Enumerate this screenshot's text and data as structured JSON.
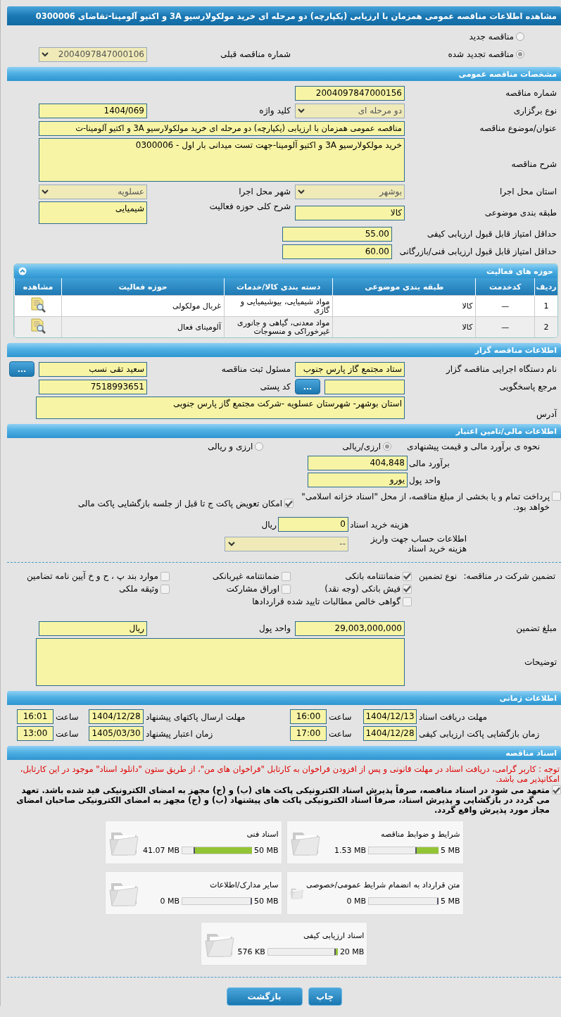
{
  "title": "مشاهده اطلاعات مناقصه عمومی همزمان با ارزیابی (یکپارچه) دو مرحله ای خرید مولکولارسیو 3A و اکتیو آلومینا-تقاضای 0300006",
  "tender_kind": [
    {
      "label": "مناقصه جدید",
      "selected": false
    },
    {
      "label": "مناقصه تجدید شده",
      "selected": true
    }
  ],
  "previous_tender": {
    "label": "شماره مناقصه قبلی",
    "value": "2004097847000106"
  },
  "general": {
    "title": "مشخصات مناقصه عمومی",
    "rows": [
      [
        {
          "label": "شماره مناقصه",
          "kind": "text",
          "value": "2004097847000156"
        }
      ],
      [
        {
          "label": "نوع برگزاری",
          "kind": "select",
          "value": "دو مرحله ای"
        },
        {
          "label": "کلید واژه",
          "kind": "text",
          "value": "1404/069"
        }
      ],
      [
        {
          "label": "عنوان/موضوع مناقصه",
          "kind": "wide",
          "value": "مناقصه عمومی همزمان با ارزیابی (یکپارچه) دو مرحله ای خرید مولکولارسیو 3A و اکتیو آلومینا-ت"
        }
      ],
      [
        {
          "label": "شرح مناقصه",
          "kind": "area",
          "value": "خرید مولکولارسیو 3A و اکتیو آلومینا-جهت تست میدانی بار اول - 0300006"
        }
      ],
      [
        {
          "label": "استان محل اجرا",
          "kind": "select",
          "value": "بوشهر"
        },
        {
          "label": "شهر محل اجرا",
          "kind": "select",
          "value": "عسلویه"
        }
      ],
      [
        {
          "label": "طبقه بندی موضوعی",
          "kind": "text",
          "value": "کالا"
        },
        {
          "label": "شرح کلی حوزه فعالیت",
          "kind": "tall",
          "value": "شیمیایی"
        }
      ],
      [
        {
          "label": "حداقل امتیاز قابل قبول ارزیابی کیفی",
          "kind": "text",
          "value": "55.00"
        }
      ],
      [
        {
          "label": "حداقل امتیاز قابل قبول ارزیابی فنی/بازرگانی",
          "kind": "text",
          "value": "60.00"
        }
      ]
    ]
  },
  "activities": {
    "title": "حوزه های فعالیت",
    "columns": [
      "ردیف",
      "کدخدمت",
      "طبقه بندی موضوعی",
      "دسته بندی کالا/خدمات",
      "حوزه فعالیت",
      "مشاهده"
    ],
    "rows": [
      {
        "cells": [
          "1",
          "—",
          "کالا",
          "مواد شیمیایی، بیوشیمیایی و گازی",
          "غربال مولکولی"
        ]
      },
      {
        "cells": [
          "2",
          "—",
          "کالا",
          "مواد معدنی، گیاهی و جانوری غیرخوراکی و منسوجات",
          "آلومینای فعال"
        ]
      }
    ]
  },
  "organizer": {
    "title": "اطلاعات مناقصه گزار",
    "rows": [
      [
        {
          "label": "نام دستگاه اجرایی مناقصه گزار",
          "kind": "text",
          "value": "ستاد مجتمع گاز پارس جنوب"
        },
        {
          "label": "مسئول ثبت مناقصه",
          "kind": "lookup",
          "value": "سعید تقی نسب",
          "button": "..."
        }
      ],
      [
        {
          "label": "مرجع پاسخگویی",
          "kind": "lookup",
          "button": "..."
        },
        {
          "label": "کد پستی",
          "kind": "text",
          "value": "7518993651"
        }
      ],
      [
        {
          "label": "آدرس",
          "kind": "address",
          "value": "استان بوشهر- شهرستان عسلویه -شرکت مجتمع گاز پارس جنوبی"
        }
      ]
    ]
  },
  "finance": {
    "title": "اطلاعات مالی/تامین اعتبار",
    "estimate_method": {
      "label": "نحوه ی برآورد مالی و قیمت پیشنهادی",
      "options": [
        {
          "label": "ارزی/ریالی",
          "selected": true
        },
        {
          "label": "ارزی و ریالی",
          "selected": false
        }
      ]
    },
    "fields": [
      {
        "label": "برآورد مالی",
        "value": "404,848"
      },
      {
        "label": "واحد پول",
        "value": "یورو"
      }
    ],
    "options": [
      {
        "label": "پرداخت تمام و یا بخشی از مبلغ مناقصه، از محل \"اسناد خزانه اسلامی\" خواهد بود.",
        "checked": false
      },
      {
        "label": "امکان تعویض پاکت ج تا قبل از جلسه بازگشایی پاکت مالی",
        "checked": true
      }
    ],
    "document_fee": {
      "label": "هزینه خرید اسناد",
      "value": "0",
      "unit": "ریال"
    },
    "account": {
      "label": "اطلاعات حساب جهت واریز هزینه خرید اسناد",
      "value": "--"
    }
  },
  "guarantee": {
    "label": "تضمین شرکت در مناقصه:",
    "type_label": "نوع تضمین",
    "types": [
      {
        "label": "ضمانتنامه بانکی",
        "checked": true
      },
      {
        "label": "ضمانتنامه غیربانکی",
        "checked": false
      },
      {
        "label": "موارد بند پ ، ح و خ آیین نامه تضامین",
        "checked": false
      },
      {
        "label": "فیش بانکی (وجه نقد)",
        "checked": true
      },
      {
        "label": "اوراق مشارکت",
        "checked": false
      },
      {
        "label": "وثیقه ملکی",
        "checked": false
      },
      {
        "label": "گواهی خالص مطالبات تایید شده قراردادها",
        "checked": false
      }
    ],
    "amount": {
      "label": "مبلغ تضمین",
      "value": "29,003,000,000"
    },
    "currency": {
      "label": "واحد پول",
      "value": "ریال"
    },
    "notes": {
      "label": "توضیحات"
    }
  },
  "schedule": {
    "title": "اطلاعات زمانی",
    "items": [
      {
        "label": "مهلت دریافت اسناد",
        "date": "1404/12/13",
        "time_label": "ساعت",
        "time": "16:00"
      },
      {
        "label": "مهلت ارسال پاکتهای پیشنهاد",
        "date": "1404/12/28",
        "time_label": "ساعت",
        "time": "16:01"
      },
      {
        "label": "زمان بازگشایی پاکت ارزیابی کیفی",
        "date": "1404/12/28",
        "time_label": "ساعت",
        "time": "17:00"
      },
      {
        "label": "زمان اعتبار پیشنهاد",
        "date": "1405/03/30",
        "time_label": "ساعت",
        "time": "13:00"
      }
    ]
  },
  "documents": {
    "title": "اسناد مناقصه",
    "notice": "توجه : کاربر گرامی، دریافت اسناد در مهلت قانونی و پس از افزودن فراخوان به کارتابل \"فراخوان های من\"، از طریق ستون \"دانلود اسناد\" موجود در این کارتابل، امکانپذیر می باشد.",
    "commitment": {
      "text": "متعهد می شود در اسناد مناقصه، صرفاً پذیرش اسناد الکترونیکی پاکت های (ب) و (ج) مجهز به امضای الکترونیکی قید شده باشد. تعهد می گردد در بازگشایی و پذیرش اسناد، صرفاً اسناد الکترونیکی پاکت های پیشنهاد (ب) و (ج) مجهز به امضای الکترونیکی صاحبان امضای مجاز مورد پذیرش واقع گردد.",
      "checked": true
    },
    "files": [
      {
        "name": "شرایط و ضوابط مناقصه",
        "capacity": "5 MB",
        "used": "1.53 MB",
        "level": 0.31
      },
      {
        "name": "اسناد فنی",
        "capacity": "50 MB",
        "used": "41.07 MB",
        "level": 0.82
      },
      {
        "name": "متن قرارداد به انضمام شرایط عمومی/خصوصی",
        "capacity": "5 MB",
        "used": "0 MB",
        "level": 0
      },
      {
        "name": "سایر مدارک/اطلاعات",
        "capacity": "50 MB",
        "used": "0 MB",
        "level": 0
      },
      {
        "name": "اسناد ارزیابی کیفی",
        "capacity": "20 MB",
        "used": "576 KB",
        "level": 0.03
      }
    ]
  },
  "buttons": [
    "چاپ",
    "بازگشت"
  ]
}
